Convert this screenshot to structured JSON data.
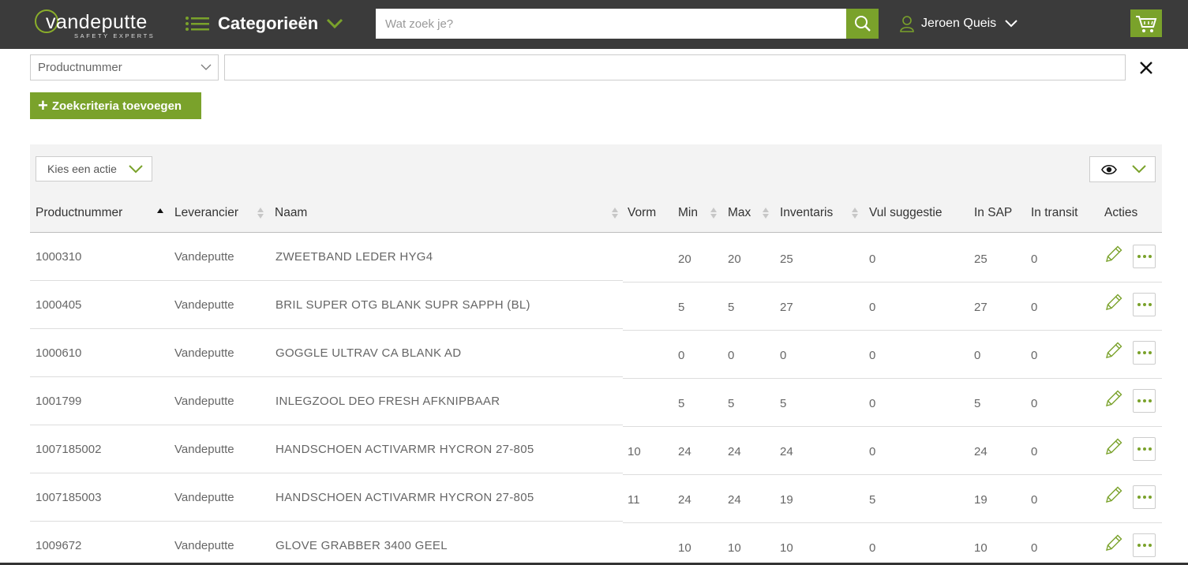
{
  "header": {
    "logo_text": "vandeputte",
    "logo_tagline": "SAFETY EXPERTS",
    "categories_label": "Categorieën",
    "search_placeholder": "Wat zoek je?",
    "user_name": "Jeroen Queis",
    "accent_color": "#7aa22b",
    "bar_color": "#3b3b3b"
  },
  "filter": {
    "field_selected": "Productnummer",
    "value": "",
    "add_criteria_label": "Zoekcriteria toevoegen"
  },
  "toolbar": {
    "action_placeholder": "Kies een actie"
  },
  "table": {
    "columns": [
      {
        "label": "Productnummer",
        "sort": "ascending"
      },
      {
        "label": "Leverancier",
        "sort": "sortable"
      },
      {
        "label": "Naam",
        "sort": "sortable"
      },
      {
        "label": "Vorm",
        "sort": "none"
      },
      {
        "label": "Min",
        "sort": "sortable"
      },
      {
        "label": "Max",
        "sort": "sortable"
      },
      {
        "label": "Inventaris",
        "sort": "sortable"
      },
      {
        "label": "Vul suggestie",
        "sort": "none"
      },
      {
        "label": "In SAP",
        "sort": "none"
      },
      {
        "label": "In transit",
        "sort": "none"
      },
      {
        "label": "Acties",
        "sort": "none"
      }
    ],
    "rows": [
      {
        "productnummer": "1000310",
        "leverancier": "Vandeputte",
        "naam": "ZWEETBAND LEDER HYG4",
        "vorm": "",
        "min": "20",
        "max": "20",
        "inventaris": "25",
        "vul_suggestie": "0",
        "in_sap": "25",
        "in_transit": "0"
      },
      {
        "productnummer": "1000405",
        "leverancier": "Vandeputte",
        "naam": "BRIL SUPER OTG BLANK SUPR SAPPH (BL)",
        "vorm": "",
        "min": "5",
        "max": "5",
        "inventaris": "27",
        "vul_suggestie": "0",
        "in_sap": "27",
        "in_transit": "0"
      },
      {
        "productnummer": "1000610",
        "leverancier": "Vandeputte",
        "naam": "GOGGLE ULTRAV CA BLANK AD",
        "vorm": "",
        "min": "0",
        "max": "0",
        "inventaris": "0",
        "vul_suggestie": "0",
        "in_sap": "0",
        "in_transit": "0"
      },
      {
        "productnummer": "1001799",
        "leverancier": "Vandeputte",
        "naam": "INLEGZOOL DEO FRESH AFKNIPBAAR",
        "vorm": "",
        "min": "5",
        "max": "5",
        "inventaris": "5",
        "vul_suggestie": "0",
        "in_sap": "5",
        "in_transit": "0"
      },
      {
        "productnummer": "1007185002",
        "leverancier": "Vandeputte",
        "naam": "HANDSCHOEN ACTIVARMR HYCRON 27-805",
        "vorm": "10",
        "min": "24",
        "max": "24",
        "inventaris": "24",
        "vul_suggestie": "0",
        "in_sap": "24",
        "in_transit": "0"
      },
      {
        "productnummer": "1007185003",
        "leverancier": "Vandeputte",
        "naam": "HANDSCHOEN ACTIVARMR HYCRON 27-805",
        "vorm": "11",
        "min": "24",
        "max": "24",
        "inventaris": "19",
        "vul_suggestie": "5",
        "in_sap": "19",
        "in_transit": "0"
      },
      {
        "productnummer": "1009672",
        "leverancier": "Vandeputte",
        "naam": "GLOVE GRABBER 3400 GEEL",
        "vorm": "",
        "min": "10",
        "max": "10",
        "inventaris": "10",
        "vul_suggestie": "0",
        "in_sap": "10",
        "in_transit": "0"
      }
    ]
  }
}
